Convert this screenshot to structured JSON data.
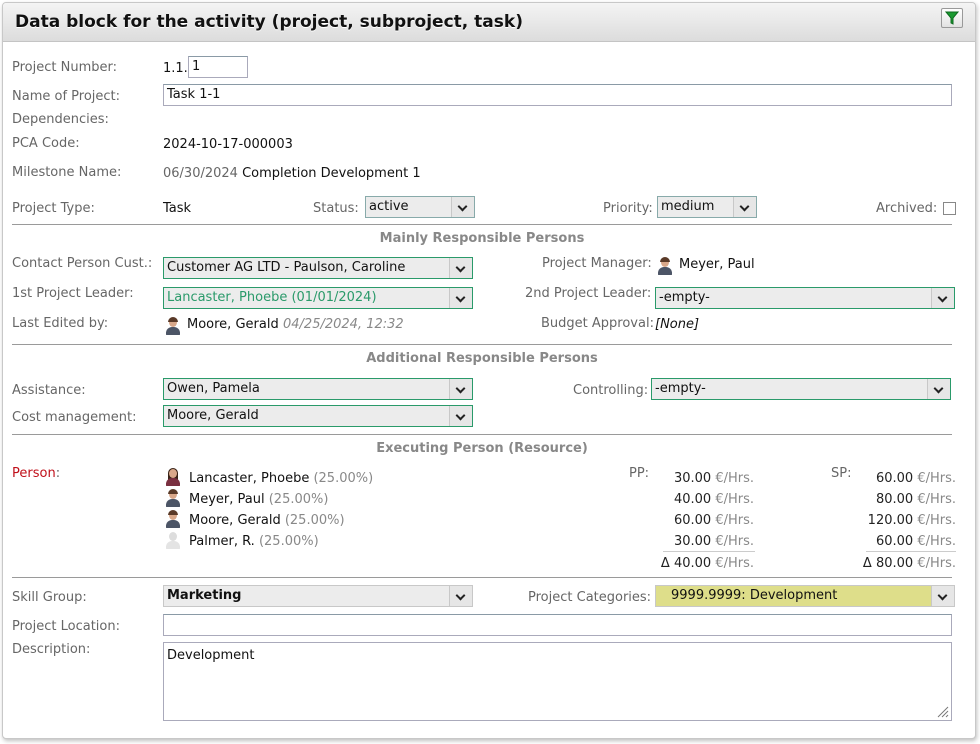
{
  "header": {
    "title": "Data block for the activity (project, subproject, task)",
    "filter_icon": "filter-icon"
  },
  "project": {
    "number_label": "Project Number:",
    "number_prefix": "1.1.",
    "number_value": "1",
    "name_label": "Name of Project:",
    "name_value": "Task 1-1",
    "dependencies_label": "Dependencies:",
    "pca_label": "PCA Code:",
    "pca_value": "2024-10-17-000003",
    "milestone_label": "Milestone Name:",
    "milestone_date": "06/30/2024",
    "milestone_name": "Completion Development 1",
    "type_label": "Project Type:",
    "type_value": "Task",
    "status_label": "Status:",
    "status_value": "active",
    "priority_label": "Priority:",
    "priority_value": "medium",
    "archived_label": "Archived:"
  },
  "mainly": {
    "title": "Mainly Responsible Persons",
    "contact_label": "Contact Person Cust.:",
    "contact_value": "Customer AG LTD - Paulson, Caroline",
    "pm_label": "Project Manager:",
    "pm_value": "Meyer, Paul",
    "leader1_label": "1st Project Leader:",
    "leader1_value": "Lancaster, Phoebe (01/01/2024)",
    "leader2_label": "2nd Project Leader:",
    "leader2_value": "-empty-",
    "edited_label": "Last Edited by:",
    "edited_value": "Moore, Gerald",
    "edited_time": "04/25/2024, 12:32",
    "budget_label": "Budget Approval:",
    "budget_value": "[None]",
    "accent_color": "#2a9a6a"
  },
  "additional": {
    "title": "Additional Responsible Persons",
    "assistance_label": "Assistance:",
    "assistance_value": "Owen, Pamela",
    "controlling_label": "Controlling:",
    "controlling_value": "-empty-",
    "cost_label": "Cost management:",
    "cost_value": "Moore, Gerald"
  },
  "executing": {
    "title": "Executing Person (Resource)",
    "person_label": "Person",
    "person_colon": ":",
    "pp_label": "PP:",
    "sp_label": "SP:",
    "unit": "€/Hrs.",
    "people": [
      {
        "name": "Lancaster, Phoebe",
        "share": "(25.00%)",
        "pp": "30.00",
        "sp": "60.00"
      },
      {
        "name": "Meyer, Paul",
        "share": "(25.00%)",
        "pp": "40.00",
        "sp": "80.00"
      },
      {
        "name": "Moore, Gerald",
        "share": "(25.00%)",
        "pp": "60.00",
        "sp": "120.00"
      },
      {
        "name": "Palmer, R.",
        "share": "(25.00%)",
        "pp": "30.00",
        "sp": "60.00"
      }
    ],
    "pp_total": "Δ 40.00",
    "sp_total": "Δ 80.00",
    "person_label_color": "#c0101a"
  },
  "bottom": {
    "skill_label": "Skill Group:",
    "skill_value": "Marketing",
    "categories_label": "Project Categories:",
    "categories_value": "9999.9999: Development",
    "categories_color": "#dede8a",
    "location_label": "Project Location:",
    "location_value": "",
    "description_label": "Description:",
    "description_value": "Development"
  }
}
